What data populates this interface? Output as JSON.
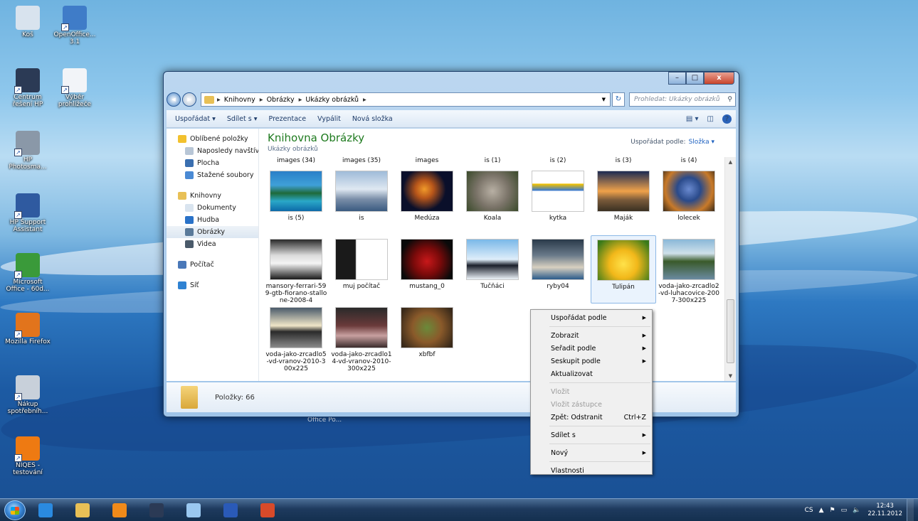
{
  "desktop": {
    "icons": [
      {
        "label": "Koš",
        "icon": "recycle-bin-icon",
        "color": "#d8e3ee"
      },
      {
        "label": "OpenOffice... 3.1",
        "icon": "openoffice-icon",
        "color": "#3f7cc8"
      },
      {
        "label": "Centrum řešení HP",
        "icon": "hp-logo-icon",
        "color": "#2b3a55"
      },
      {
        "label": "Výběr prohlížeče",
        "icon": "browser-choice-icon",
        "color": "#f2f4f8"
      },
      {
        "label": "HP Photosma...",
        "icon": "hp-photosmart-icon",
        "color": "#8a98a8"
      },
      {
        "label": "HP Support Assistant",
        "icon": "hp-support-icon",
        "color": "#2f5aa0"
      },
      {
        "label": "Microsoft Office - 60d...",
        "icon": "ms-office-icon",
        "color": "#3a9a3a"
      },
      {
        "label": "Mozilla Firefox",
        "icon": "firefox-icon",
        "color": "#e2741c"
      },
      {
        "label": "Nákup spotřebníh...",
        "icon": "printer-icon",
        "color": "#c8d0da"
      },
      {
        "label": "NIQES - testování",
        "icon": "niqes-icon",
        "color": "#ee7a12"
      }
    ],
    "ghost_label": "Office Po..."
  },
  "window": {
    "controls": {
      "min": "–",
      "max": "□",
      "close": "x"
    },
    "address": {
      "segments": [
        "Knihovny",
        "Obrázky",
        "Ukázky obrázků"
      ],
      "separator": "▸"
    },
    "search_placeholder": "Prohledat: Ukázky obrázků",
    "toolbar": [
      "Uspořádat ▾",
      "Sdílet s ▾",
      "Prezentace",
      "Vypálit",
      "Nová složka"
    ],
    "nav": [
      {
        "label": "Oblíbené položky",
        "sub": false,
        "icon": "star-icon",
        "color": "#f2c12e"
      },
      {
        "label": "Naposledy navštívené",
        "sub": true,
        "icon": "recent-places-icon",
        "color": "#b8c6d6"
      },
      {
        "label": "Plocha",
        "sub": true,
        "icon": "desktop-icon",
        "color": "#3b6fb0"
      },
      {
        "label": "Stažené soubory",
        "sub": true,
        "icon": "downloads-icon",
        "color": "#4a8ad4"
      },
      {
        "gap": true
      },
      {
        "label": "Knihovny",
        "sub": false,
        "icon": "libraries-icon",
        "color": "#e8c056"
      },
      {
        "label": "Dokumenty",
        "sub": true,
        "icon": "documents-icon",
        "color": "#d9e4ef"
      },
      {
        "label": "Hudba",
        "sub": true,
        "icon": "music-icon",
        "color": "#2a72c8"
      },
      {
        "label": "Obrázky",
        "sub": true,
        "icon": "pictures-icon",
        "color": "#5a7a9a",
        "selected": true
      },
      {
        "label": "Videa",
        "sub": true,
        "icon": "videos-icon",
        "color": "#4a5a6a"
      },
      {
        "gap": true
      },
      {
        "label": "Počítač",
        "sub": false,
        "icon": "computer-icon",
        "color": "#4a78b8"
      },
      {
        "gap": true
      },
      {
        "label": "Síť",
        "sub": false,
        "icon": "network-icon",
        "color": "#2f82d2"
      }
    ],
    "library_title": "Knihovna Obrázky",
    "library_subtitle": "Ukázky obrázků",
    "arrange_label": "Uspořádat podle:",
    "arrange_value": "Složka ▾",
    "top_labels": [
      "images (34)",
      "images (35)",
      "images",
      "is (1)",
      "is (2)",
      "is (3)",
      "is (4)"
    ],
    "rows": [
      [
        {
          "caption": "is (5)",
          "bg": "linear-gradient(#2a7fc8 0%, #3fa0d8 35%, #1e6a3a 55%, #2aa8c8 75%, #0d6aa8 100%)"
        },
        {
          "caption": "is",
          "bg": "linear-gradient(#9fbbd8 0%, #dfe8f2 45%, #7a8ea8 70%, #3a5a80 100%)"
        },
        {
          "caption": "Medúza",
          "bg": "radial-gradient(circle at 45% 45%, #f09a2a 0%, #b8561a 25%, #0a0f2a 60%)"
        },
        {
          "caption": "Koala",
          "bg": "radial-gradient(circle at 50% 50%, #b8b0a4 0%, #7a7368 50%, #3a4a2a 100%)"
        },
        {
          "caption": "kytka",
          "bg": "linear-gradient(#ffffff 0%, #ffffff 30%, #f2c200 32%, #3a7ad0 48%, #ffffff 50%, #ffffff 100%)"
        },
        {
          "caption": "Maják",
          "bg": "linear-gradient(#1c2a52 0%, #f0a24a 50%, #7a5a3a 72%, #3a3022 100%)"
        },
        {
          "caption": "lolecek",
          "bg": "radial-gradient(circle at 50% 45%, #6a8ad0 0%, #2a4a8a 35%, #c87a2a 70%, #3a2a18 100%)"
        }
      ],
      [
        {
          "caption": "mansory-ferrari-599-gtb-fiorano-stallone-2008-4",
          "bg": "linear-gradient(#2a2a2a 0%, #dcdcdc 40%, #f4f4f4 60%, #1a1a1a 100%)"
        },
        {
          "caption": "muj počítač",
          "bg": "linear-gradient(90deg, #1a1a1a 0%, #1a1a1a 38%, #ffffff 40%, #ffffff 100%)"
        },
        {
          "caption": "mustang_0",
          "bg": "radial-gradient(circle at 50% 55%, #c8181a 0%, #7a0a0a 40%, #0a0a0a 80%)"
        },
        {
          "caption": "Tučňáci",
          "bg": "linear-gradient(#7ab8e8 0%, #dfeefa 50%, #1a1f2a 65%, #eef4fa 100%)"
        },
        {
          "caption": "ryby04",
          "bg": "linear-gradient(#2a3a4a 0%, #6a7a8a 40%, #d8d0c0 70%, #2a5a8a 100%)"
        },
        {
          "caption": "Tulipán",
          "bg": "radial-gradient(circle at 50% 60%, #ffe24a 0%, #f2b81a 40%, #3a7a1a 90%)",
          "selected": true
        },
        {
          "caption": "voda-jako-zrcadlo2-vd-luhacovice-2007-300x225",
          "bg": "linear-gradient(#8ab8d8 0%, #cfe0ea 35%, #3a5a2a 55%, #6a8aa0 100%)"
        }
      ],
      [
        {
          "caption": "voda-jako-zrcadlo5-vd-vranov-2010-300x225",
          "bg": "linear-gradient(#4a5a6a 0%, #f0e6c8 45%, #2a2a2a 60%, #8a8a8a 100%)"
        },
        {
          "caption": "voda-jako-zrcadlo14-vd-vranov-2010-300x225",
          "bg": "linear-gradient(#2a2a2a 0%, #6a3a3a 45%, #c8a0a0 70%, #3a2a2a 100%)"
        },
        {
          "caption": "xbfbf",
          "bg": "radial-gradient(circle at 50% 50%, #6a8a3a 0%, #8a5a2a 45%, #3a2a1a 90%)"
        }
      ]
    ],
    "status": "Položky: 66"
  },
  "context_menu": [
    {
      "label": "Uspořádat podle",
      "submenu": true
    },
    {
      "sep": true
    },
    {
      "label": "Zobrazit",
      "submenu": true
    },
    {
      "label": "Seřadit podle",
      "submenu": true
    },
    {
      "label": "Seskupit podle",
      "submenu": true
    },
    {
      "label": "Aktualizovat"
    },
    {
      "sep": true
    },
    {
      "label": "Vložit",
      "disabled": true
    },
    {
      "label": "Vložit zástupce",
      "disabled": true
    },
    {
      "label": "Zpět: Odstranit",
      "shortcut": "Ctrl+Z"
    },
    {
      "sep": true
    },
    {
      "label": "Sdílet s",
      "submenu": true
    },
    {
      "sep": true
    },
    {
      "label": "Nový",
      "submenu": true
    },
    {
      "sep": true
    },
    {
      "label": "Vlastnosti"
    }
  ],
  "taskbar": {
    "items": [
      {
        "icon": "internet-explorer-icon",
        "color": "#2a8ae0"
      },
      {
        "icon": "file-explorer-icon",
        "color": "#e8c056"
      },
      {
        "icon": "media-player-icon",
        "color": "#f08a1a"
      },
      {
        "icon": "hp-icon",
        "color": "#2b3a55"
      },
      {
        "icon": "paint-icon",
        "color": "#9ac8f0"
      },
      {
        "icon": "word-icon",
        "color": "#2a5ab8"
      },
      {
        "icon": "office-icon",
        "color": "#d84a2a"
      }
    ],
    "tray": {
      "lang": "CS",
      "show_hidden": "▲",
      "flag": "⚑",
      "network": "▭",
      "volume": "🔈",
      "time": "12:43",
      "date": "22.11.2012"
    }
  }
}
